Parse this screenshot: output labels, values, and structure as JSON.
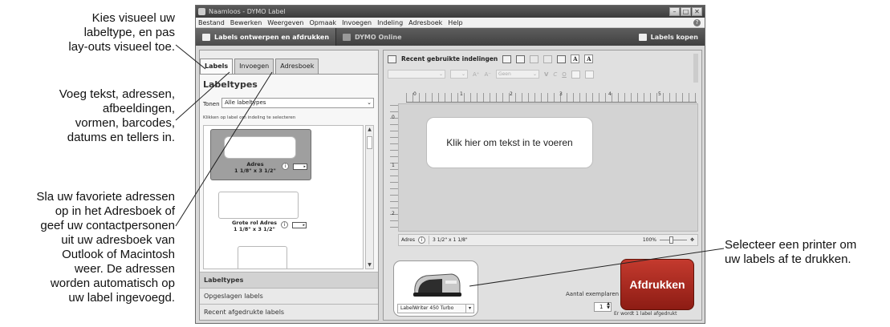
{
  "callouts": {
    "labeltype": [
      "Kies visueel uw",
      "labeltype, en pas",
      "lay-outs visueel toe."
    ],
    "insert": [
      "Voeg tekst, adressen,",
      "afbeeldingen,",
      "vormen, barcodes,",
      "datums en tellers in."
    ],
    "addressbook": [
      "Sla uw favoriete adressen",
      "op in het Adresboek of",
      "geef uw contactpersonen",
      "uit uw adresboek van",
      "Outlook of Macintosh",
      "weer. De adressen",
      "worden automatisch op",
      "uw label ingevoegd."
    ],
    "printer": [
      "Selecteer een printer om",
      "uw labels af te drukken."
    ]
  },
  "window": {
    "title": "Naamloos - DYMO Label",
    "menu": [
      "Bestand",
      "Bewerken",
      "Weergeven",
      "Opmaak",
      "Invoegen",
      "Indeling",
      "Adresboek",
      "Help"
    ],
    "toolbar": {
      "design_tab": "Labels ontwerpen en afdrukken",
      "online_tab": "DYMO Online",
      "buy_labels": "Labels kopen"
    }
  },
  "left_panel": {
    "tabs": [
      "Labels",
      "Invoegen",
      "Adresboek"
    ],
    "title": "Labeltypes",
    "show_label": "Tonen",
    "show_value": "Alle labeltypes",
    "hint": "Klikken op label om indeling te selecteren",
    "label_items": [
      {
        "name": "Adres",
        "size": "1 1/8\" x 3 1/2\""
      },
      {
        "name": "Grote rol Adres",
        "size": "1 1/8\" x 3 1/2\""
      }
    ],
    "accordion": [
      "Labeltypes",
      "Opgeslagen labels",
      "Recent afgedrukte labels"
    ]
  },
  "editor": {
    "recent_layouts": "Recent gebruikte indelingen",
    "color_value": "Geen",
    "ruler_numbers": [
      "0",
      "1",
      "2",
      "3",
      "4",
      "5"
    ],
    "vruler_numbers": [
      "0",
      "1",
      "2"
    ],
    "label_placeholder": "Klik hier om tekst in te voeren",
    "status_type": "Adres",
    "status_size": "3 1/2\" x 1 1/8\"",
    "zoom": "100%",
    "printer_name": "LabelWriter 450 Turbo",
    "copies_label": "Aantal exemplaren",
    "copies_value": "1",
    "print_button": "Afdrukken",
    "print_message": "Er wordt 1 label afgedrukt"
  }
}
